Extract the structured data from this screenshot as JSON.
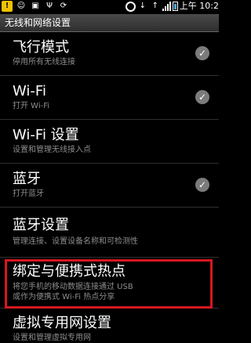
{
  "status_bar": {
    "time": "上午 10:2",
    "icons": [
      "warning-icon",
      "chat-icon",
      "map-icon",
      "usb-icon",
      "sync-icon",
      "circle-icon",
      "download-icon",
      "upload-icon",
      "signal-icon",
      "battery-icon"
    ]
  },
  "header": {
    "title": "无线和网络设置"
  },
  "settings": {
    "items": [
      {
        "title": "飞行模式",
        "subtitle": "停用所有无线连接",
        "checked": true
      },
      {
        "title": "Wi-Fi",
        "subtitle": "打开 Wi-Fi",
        "checked": true
      },
      {
        "title": "Wi-Fi 设置",
        "subtitle": "设置和管理无线接入点",
        "checked": false
      },
      {
        "title": "蓝牙",
        "subtitle": "打开蓝牙",
        "checked": true
      },
      {
        "title": "蓝牙设置",
        "subtitle": "管理连接、设置设备名称和可检测性",
        "checked": false
      },
      {
        "title": "绑定与便携式热点",
        "subtitle": "将您手机的移动数据连接通过 USB",
        "subtitle2": "或作为便携式 Wi-Fi 热点分享",
        "checked": false,
        "highlighted": true
      },
      {
        "title": "虚拟专用网设置",
        "subtitle": "设置和管理虚拟专用网",
        "checked": false
      }
    ]
  },
  "colors": {
    "highlight_border": "#d6181f",
    "check_gray": "#7b7b7b",
    "background": "#000000"
  }
}
